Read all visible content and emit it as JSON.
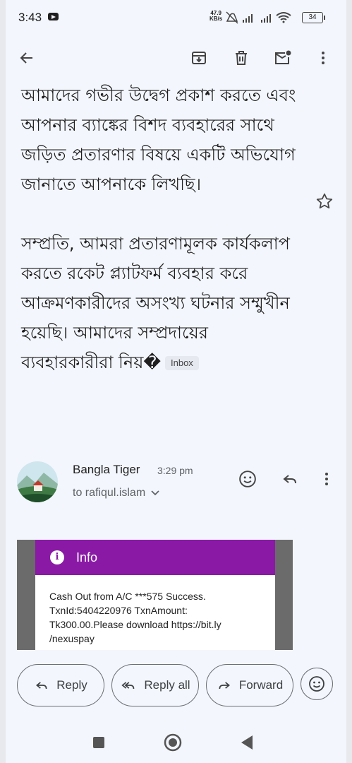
{
  "status_bar": {
    "time": "3:43",
    "net_speed_value": "47.9",
    "net_speed_unit": "KB/s",
    "battery": "34"
  },
  "toolbar": {
    "back_icon": "arrow-back-icon",
    "archive_icon": "archive-icon",
    "delete_icon": "delete-icon",
    "mark_unread_icon": "mark-unread-icon",
    "more_icon": "more-vert-icon"
  },
  "message": {
    "paragraph1": "আমাদের গভীর উদ্বেগ প্রকাশ করতে এবং আপনার ব্যাঙ্কের বিশদ ব্যবহারের সাথে জড়িত প্রতারণার বিষয়ে একটি অভিযোগ জানাতে আপনাকে লিখছি।",
    "paragraph2": "সম্প্রতি, আমরা প্রতারণামূলক কার্যকলাপ করতে রকেট প্ল্যাটফর্ম ব্যবহার করে আক্রমণকারীদের অসংখ্য ঘটনার সম্মুখীন হয়েছি। আমাদের সম্প্রদায়ের ব্যবহারকারীরা নিয়�",
    "label_chip": "Inbox"
  },
  "sender": {
    "name": "Bangla Tiger",
    "time": "3:29 pm",
    "recipient": "to rafiqul.islam"
  },
  "attachment": {
    "title": "Info",
    "text": "Cash Out from A/C ***575 Success. TxnId:5404220976 TxnAmount: Tk300.00.Please download https://bit.ly /nexuspay"
  },
  "actions": {
    "reply": "Reply",
    "reply_all": "Reply all",
    "forward": "Forward"
  },
  "colors": {
    "background": "#f3f6fc",
    "attachment_header": "#8a1aa6"
  }
}
